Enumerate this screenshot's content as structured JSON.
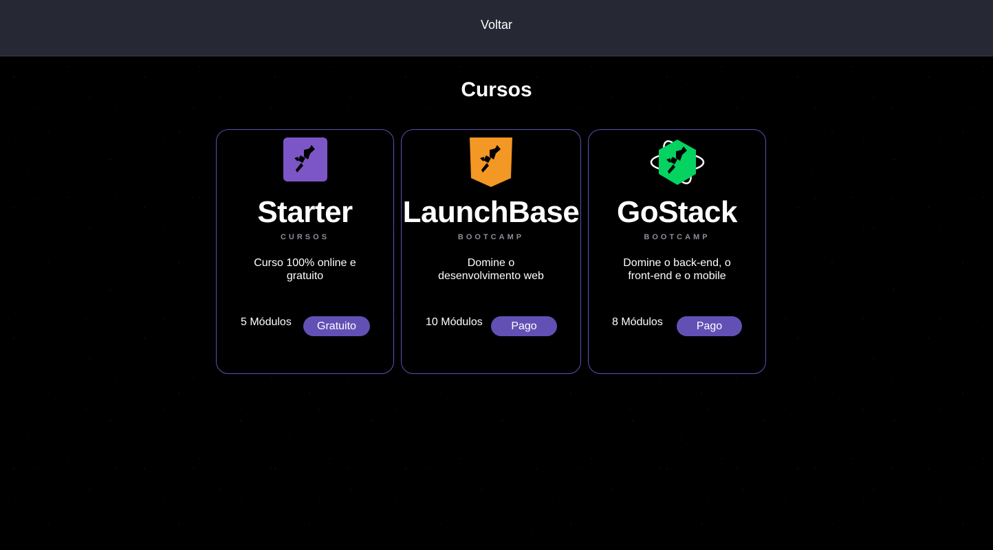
{
  "header": {
    "back_label": "Voltar"
  },
  "page": {
    "title": "Cursos"
  },
  "courses": [
    {
      "name": "Starter",
      "kind": "CURSOS",
      "description_line1": "Curso 100% online e",
      "description_line2": "gratuito",
      "modules": "5 Módulos",
      "price": "Gratuito",
      "logo_color": "#7c56c7",
      "logo_icon": "rocket-square-icon"
    },
    {
      "name": "LaunchBase",
      "kind": "BOOTCAMP",
      "description_line1": "Domine o",
      "description_line2": "desenvolvimento web",
      "modules": "10 Módulos",
      "price": "Pago",
      "logo_color": "#f39725",
      "logo_icon": "rocket-shield-icon"
    },
    {
      "name": "GoStack",
      "kind": "BOOTCAMP",
      "description_line1": "Domine o back-end, o",
      "description_line2": "front-end e o mobile",
      "modules": "8 Módulos",
      "price": "Pago",
      "logo_color": "#04d361",
      "logo_icon": "rocket-atom-icon"
    }
  ],
  "colors": {
    "topbar_bg": "#262834",
    "card_border": "#5b52b5",
    "badge_bg": "#6350b5",
    "muted_text": "#8d8d99"
  }
}
